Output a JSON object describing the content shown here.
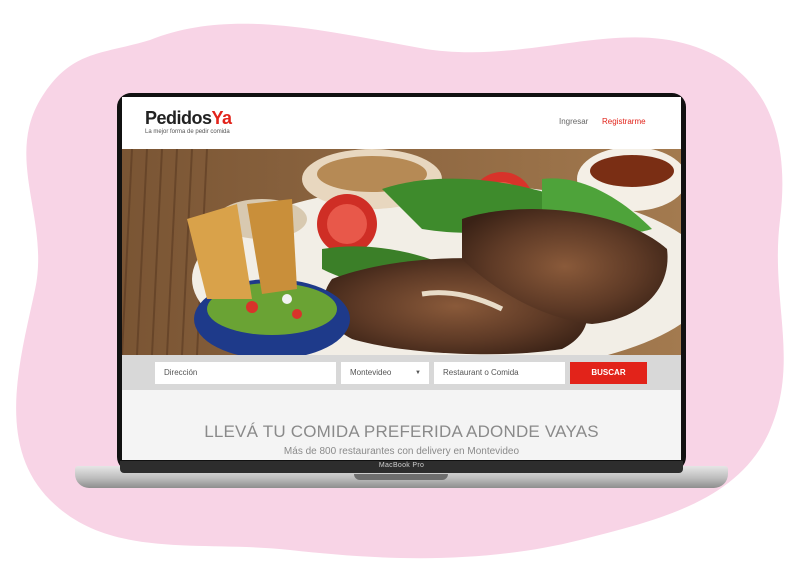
{
  "header": {
    "logo_main": "Pedidos",
    "logo_accent": "Ya",
    "tagline": "La mejor forma de pedir comida",
    "login_label": "Ingresar",
    "register_label": "Registrarme"
  },
  "search": {
    "address_placeholder": "Dirección",
    "city_value": "Montevideo",
    "food_placeholder": "Restaurant o Comida",
    "button_label": "BUSCAR"
  },
  "main": {
    "headline": "LLEVÁ TU COMIDA PREFERIDA ADONDE VAYAS",
    "subline": "Más de 800 restaurantes con delivery en Montevideo"
  },
  "device": {
    "label": "MacBook Pro"
  },
  "colors": {
    "brand_red": "#e2231a",
    "background_blob": "#f8d4e6"
  }
}
